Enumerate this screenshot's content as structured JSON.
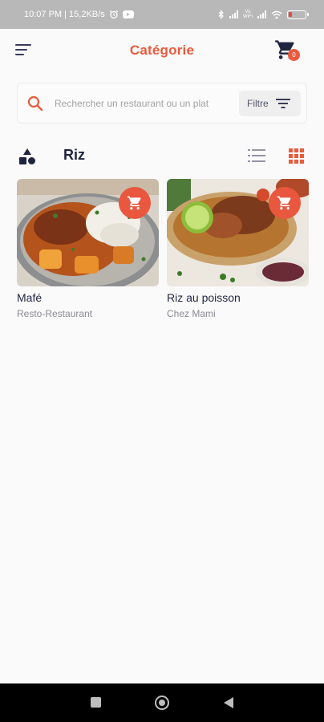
{
  "status_bar": {
    "time_speed": "10:07 PM | 15,2KB/s",
    "icons": [
      "alarm-icon",
      "youtube-icon",
      "bluetooth-icon",
      "signal-icon",
      "volte-icon",
      "signal-icon",
      "wifi-icon",
      "battery-icon"
    ],
    "lte_top": "Vo",
    "lte_bottom": "WiFi"
  },
  "header": {
    "title": "Catégorie",
    "cart_count": "0",
    "menu_icon": "menu-icon",
    "cart_icon": "cart-icon"
  },
  "search": {
    "placeholder": "Rechercher un restaurant ou un plat",
    "value": "",
    "filter_label": "Filtre"
  },
  "category": {
    "title": "Riz",
    "view_mode": "grid"
  },
  "products": [
    {
      "name": "Mafé",
      "restaurant": "Resto-Restaurant"
    },
    {
      "name": "Riz au poisson",
      "restaurant": "Chez Mami"
    }
  ],
  "colors": {
    "accent": "#ea5a3c",
    "title_dark": "#1f2440",
    "muted": "#8a8a93",
    "background": "#fafafa"
  }
}
